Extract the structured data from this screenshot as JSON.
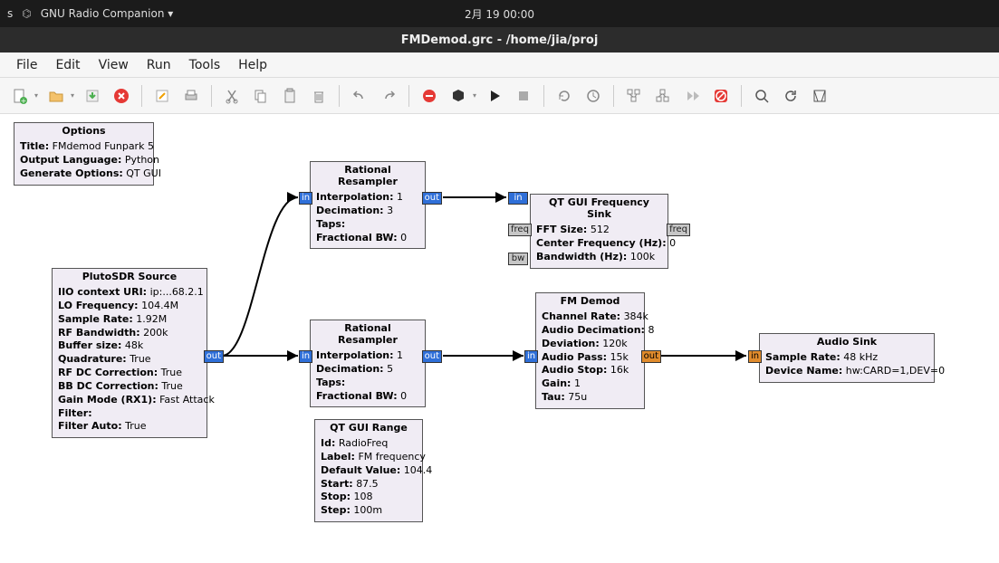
{
  "topbar": {
    "left_text": "s",
    "app_menu": "GNU Radio Companion ▾",
    "clock": "2月 19  00:00"
  },
  "title": "FMDemod.grc - /home/jia/proj",
  "menu": {
    "file": "File",
    "edit": "Edit",
    "view": "View",
    "run": "Run",
    "tools": "Tools",
    "help": "Help"
  },
  "blocks": {
    "options": {
      "title": "Options",
      "p1k": "Title:",
      "p1v": "FMdemod Funpark 5",
      "p2k": "Output Language:",
      "p2v": "Python",
      "p3k": "Generate Options:",
      "p3v": "QT GUI"
    },
    "pluto": {
      "title": "PlutoSDR Source",
      "p1k": "IIO context URI:",
      "p1v": "ip:...68.2.1",
      "p2k": "LO Frequency:",
      "p2v": "104.4M",
      "p3k": "Sample Rate:",
      "p3v": "1.92M",
      "p4k": "RF Bandwidth:",
      "p4v": "200k",
      "p5k": "Buffer size:",
      "p5v": "48k",
      "p6k": "Quadrature:",
      "p6v": "True",
      "p7k": "RF DC Correction:",
      "p7v": "True",
      "p8k": "BB DC Correction:",
      "p8v": "True",
      "p9k": "Gain Mode (RX1):",
      "p9v": "Fast Attack",
      "p10k": "Filter:",
      "p10v": "",
      "p11k": "Filter Auto:",
      "p11v": "True"
    },
    "resamp1": {
      "title": "Rational Resampler",
      "p1k": "Interpolation:",
      "p1v": "1",
      "p2k": "Decimation:",
      "p2v": "3",
      "p3k": "Taps:",
      "p3v": "",
      "p4k": "Fractional BW:",
      "p4v": "0"
    },
    "resamp2": {
      "title": "Rational Resampler",
      "p1k": "Interpolation:",
      "p1v": "1",
      "p2k": "Decimation:",
      "p2v": "5",
      "p3k": "Taps:",
      "p3v": "",
      "p4k": "Fractional BW:",
      "p4v": "0"
    },
    "range": {
      "title": "QT GUI Range",
      "p1k": "Id:",
      "p1v": "RadioFreq",
      "p2k": "Label:",
      "p2v": "FM frequency",
      "p3k": "Default Value:",
      "p3v": "104.4",
      "p4k": "Start:",
      "p4v": "87.5",
      "p5k": "Stop:",
      "p5v": "108",
      "p6k": "Step:",
      "p6v": "100m"
    },
    "freqsink": {
      "title": "QT GUI Frequency Sink",
      "p1k": "FFT Size:",
      "p1v": "512",
      "p2k": "Center Frequency (Hz):",
      "p2v": "0",
      "p3k": "Bandwidth (Hz):",
      "p3v": "100k"
    },
    "fmdemod": {
      "title": "FM Demod",
      "p1k": "Channel Rate:",
      "p1v": "384k",
      "p2k": "Audio Decimation:",
      "p2v": "8",
      "p3k": "Deviation:",
      "p3v": "120k",
      "p4k": "Audio Pass:",
      "p4v": "15k",
      "p5k": "Audio Stop:",
      "p5v": "16k",
      "p6k": "Gain:",
      "p6v": "1",
      "p7k": "Tau:",
      "p7v": "75u"
    },
    "audiosink": {
      "title": "Audio Sink",
      "p1k": "Sample Rate:",
      "p1v": "48 kHz",
      "p2k": "Device Name:",
      "p2v": "hw:CARD=1,DEV=0"
    }
  },
  "port_labels": {
    "in": "in",
    "out": "out",
    "freq": "freq",
    "bw": "bw"
  }
}
